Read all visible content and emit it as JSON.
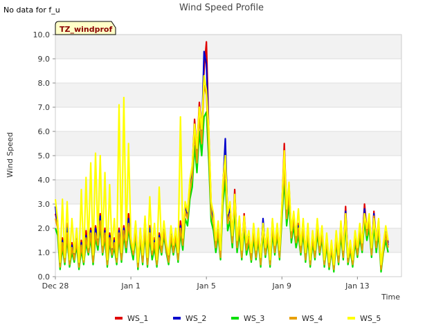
{
  "header": {
    "no_data_note": "No data for f_u",
    "badge": "TZ_windprof"
  },
  "chart_data": {
    "type": "line",
    "title": "Wind Speed Profile",
    "xlabel": "Time",
    "ylabel": "Wind Speed",
    "ylim": [
      0.0,
      10.0
    ],
    "xlim": [
      "2023-12-28",
      "2024-01-15T08:00"
    ],
    "y_ticks": [
      "0.0",
      "1.0",
      "2.0",
      "3.0",
      "4.0",
      "5.0",
      "6.0",
      "7.0",
      "8.0",
      "9.0",
      "10.0"
    ],
    "x_ticks": [
      {
        "label": "Dec 28",
        "date": "2023-12-28"
      },
      {
        "label": "Jan 1",
        "date": "2024-01-01"
      },
      {
        "label": "Jan 5",
        "date": "2024-01-05"
      },
      {
        "label": "Jan 9",
        "date": "2024-01-09"
      },
      {
        "label": "Jan 13",
        "date": "2024-01-13"
      }
    ],
    "grid": "horizontal bands",
    "legend_position": "bottom",
    "x": [
      "2023-12-28T00:00",
      "2023-12-28T03:00",
      "2023-12-28T06:00",
      "2023-12-28T09:00",
      "2023-12-28T12:00",
      "2023-12-28T15:00",
      "2023-12-28T18:00",
      "2023-12-28T21:00",
      "2023-12-29T00:00",
      "2023-12-29T03:00",
      "2023-12-29T06:00",
      "2023-12-29T09:00",
      "2023-12-29T12:00",
      "2023-12-29T15:00",
      "2023-12-29T18:00",
      "2023-12-29T21:00",
      "2023-12-30T00:00",
      "2023-12-30T03:00",
      "2023-12-30T06:00",
      "2023-12-30T09:00",
      "2023-12-30T12:00",
      "2023-12-30T15:00",
      "2023-12-30T18:00",
      "2023-12-30T21:00",
      "2023-12-31T00:00",
      "2023-12-31T03:00",
      "2023-12-31T06:00",
      "2023-12-31T09:00",
      "2023-12-31T12:00",
      "2023-12-31T15:00",
      "2023-12-31T18:00",
      "2023-12-31T21:00",
      "2024-01-01T00:00",
      "2024-01-01T03:00",
      "2024-01-01T06:00",
      "2024-01-01T09:00",
      "2024-01-01T12:00",
      "2024-01-01T15:00",
      "2024-01-01T18:00",
      "2024-01-01T21:00",
      "2024-01-02T00:00",
      "2024-01-02T03:00",
      "2024-01-02T06:00",
      "2024-01-02T09:00",
      "2024-01-02T12:00",
      "2024-01-02T15:00",
      "2024-01-02T18:00",
      "2024-01-02T21:00",
      "2024-01-03T00:00",
      "2024-01-03T03:00",
      "2024-01-03T06:00",
      "2024-01-03T09:00",
      "2024-01-03T12:00",
      "2024-01-03T15:00",
      "2024-01-03T18:00",
      "2024-01-03T21:00",
      "2024-01-04T00:00",
      "2024-01-04T03:00",
      "2024-01-04T06:00",
      "2024-01-04T09:00",
      "2024-01-04T12:00",
      "2024-01-04T15:00",
      "2024-01-04T18:00",
      "2024-01-04T21:00",
      "2024-01-05T00:00",
      "2024-01-05T03:00",
      "2024-01-05T06:00",
      "2024-01-05T09:00",
      "2024-01-05T12:00",
      "2024-01-05T15:00",
      "2024-01-05T18:00",
      "2024-01-05T21:00",
      "2024-01-06T00:00",
      "2024-01-06T03:00",
      "2024-01-06T06:00",
      "2024-01-06T09:00",
      "2024-01-06T12:00",
      "2024-01-06T15:00",
      "2024-01-06T18:00",
      "2024-01-06T21:00",
      "2024-01-07T00:00",
      "2024-01-07T03:00",
      "2024-01-07T06:00",
      "2024-01-07T09:00",
      "2024-01-07T12:00",
      "2024-01-07T15:00",
      "2024-01-07T18:00",
      "2024-01-07T21:00",
      "2024-01-08T00:00",
      "2024-01-08T03:00",
      "2024-01-08T06:00",
      "2024-01-08T09:00",
      "2024-01-08T12:00",
      "2024-01-08T15:00",
      "2024-01-08T18:00",
      "2024-01-08T21:00",
      "2024-01-09T00:00",
      "2024-01-09T03:00",
      "2024-01-09T06:00",
      "2024-01-09T09:00",
      "2024-01-09T12:00",
      "2024-01-09T15:00",
      "2024-01-09T18:00",
      "2024-01-09T21:00",
      "2024-01-10T00:00",
      "2024-01-10T03:00",
      "2024-01-10T06:00",
      "2024-01-10T09:00",
      "2024-01-10T12:00",
      "2024-01-10T15:00",
      "2024-01-10T18:00",
      "2024-01-10T21:00",
      "2024-01-11T00:00",
      "2024-01-11T03:00",
      "2024-01-11T06:00",
      "2024-01-11T09:00",
      "2024-01-11T12:00",
      "2024-01-11T15:00",
      "2024-01-11T18:00",
      "2024-01-11T21:00",
      "2024-01-12T00:00",
      "2024-01-12T03:00",
      "2024-01-12T06:00",
      "2024-01-12T09:00",
      "2024-01-12T12:00",
      "2024-01-12T15:00",
      "2024-01-12T18:00",
      "2024-01-12T21:00",
      "2024-01-13T00:00",
      "2024-01-13T03:00",
      "2024-01-13T06:00",
      "2024-01-13T09:00",
      "2024-01-13T12:00",
      "2024-01-13T15:00",
      "2024-01-13T18:00",
      "2024-01-13T21:00",
      "2024-01-14T00:00",
      "2024-01-14T03:00",
      "2024-01-14T06:00",
      "2024-01-14T09:00",
      "2024-01-14T12:00",
      "2024-01-14T15:00",
      "2024-01-14T18:00",
      "2024-01-14T21:00",
      "2024-01-15T00:00",
      "2024-01-15T03:00"
    ],
    "series": [
      {
        "name": "WS_1",
        "color": "#e00000",
        "values": [
          2.6,
          2.2,
          0.4,
          1.6,
          0.8,
          2.2,
          0.6,
          1.4,
          0.9,
          1.8,
          0.5,
          1.5,
          0.7,
          1.9,
          1.2,
          2.0,
          0.8,
          2.1,
          1.5,
          2.6,
          1.2,
          2.0,
          0.6,
          1.8,
          1.1,
          1.6,
          0.7,
          2.0,
          0.9,
          2.1,
          1.4,
          2.6,
          1.6,
          1.0,
          2.2,
          0.5,
          1.9,
          0.8,
          2.4,
          0.7,
          2.1,
          1.0,
          1.6,
          0.6,
          1.8,
          1.2,
          2.2,
          1.3,
          0.8,
          2.0,
          1.2,
          1.9,
          0.9,
          2.3,
          1.5,
          3.0,
          2.6,
          3.9,
          4.5,
          6.5,
          5.2,
          7.2,
          6.0,
          8.5,
          9.7,
          6.0,
          3.0,
          2.5,
          1.4,
          2.2,
          1.0,
          3.8,
          5.4,
          2.5,
          3.0,
          1.6,
          3.6,
          1.4,
          2.4,
          1.0,
          2.6,
          1.3,
          1.8,
          0.9,
          2.1,
          1.0,
          1.9,
          0.7,
          2.3,
          1.1,
          1.9,
          0.6,
          2.3,
          1.2,
          2.1,
          1.0,
          2.9,
          5.5,
          2.7,
          3.8,
          1.8,
          2.6,
          1.6,
          2.2,
          1.2,
          2.3,
          0.9,
          2.1,
          0.6,
          1.8,
          1.0,
          2.3,
          1.2,
          2.0,
          0.6,
          1.7,
          0.5,
          1.4,
          0.4,
          1.8,
          0.8,
          2.2,
          1.0,
          2.9,
          0.7,
          1.4,
          0.6,
          1.8,
          1.1,
          2.1,
          1.3,
          3.0,
          1.9,
          2.5,
          1.1,
          2.7,
          1.4,
          2.3,
          0.4,
          1.3,
          2.0,
          1.4
        ]
      },
      {
        "name": "WS_2",
        "color": "#0000cc",
        "values": [
          2.9,
          2.0,
          0.5,
          1.5,
          0.7,
          2.0,
          0.6,
          1.3,
          0.8,
          1.6,
          0.5,
          1.4,
          0.6,
          1.7,
          1.1,
          1.9,
          0.7,
          2.0,
          1.4,
          2.5,
          1.1,
          1.9,
          0.6,
          1.7,
          1.0,
          1.5,
          0.6,
          1.9,
          0.8,
          2.0,
          1.3,
          2.4,
          1.5,
          1.0,
          2.0,
          0.5,
          1.8,
          0.7,
          2.2,
          0.6,
          2.0,
          1.0,
          1.5,
          0.6,
          1.7,
          1.1,
          2.0,
          1.2,
          0.7,
          1.8,
          1.1,
          1.8,
          0.8,
          2.1,
          1.4,
          2.8,
          2.5,
          3.7,
          4.3,
          6.3,
          5.0,
          6.9,
          5.8,
          9.3,
          8.8,
          5.8,
          2.8,
          2.4,
          1.3,
          2.0,
          0.9,
          3.6,
          5.7,
          2.4,
          2.8,
          1.5,
          3.4,
          1.3,
          2.2,
          0.9,
          2.4,
          1.2,
          1.7,
          0.8,
          2.0,
          0.9,
          1.8,
          0.6,
          2.4,
          1.0,
          1.8,
          0.6,
          2.2,
          1.1,
          2.0,
          0.9,
          2.8,
          4.9,
          2.6,
          3.6,
          1.7,
          2.5,
          1.5,
          2.1,
          1.1,
          2.2,
          0.8,
          2.0,
          0.6,
          1.7,
          0.9,
          2.2,
          1.1,
          1.9,
          0.6,
          1.6,
          0.5,
          1.3,
          0.4,
          1.7,
          0.7,
          2.1,
          0.9,
          2.7,
          0.7,
          1.3,
          0.6,
          1.7,
          1.0,
          2.0,
          1.2,
          2.8,
          1.8,
          2.4,
          1.0,
          2.6,
          1.3,
          2.2,
          0.4,
          1.2,
          1.9,
          1.3
        ]
      },
      {
        "name": "WS_3",
        "color": "#00e000",
        "values": [
          2.0,
          1.7,
          0.3,
          1.2,
          0.5,
          1.6,
          0.4,
          1.0,
          0.6,
          1.3,
          0.3,
          1.1,
          0.5,
          1.4,
          0.9,
          1.6,
          0.5,
          1.6,
          1.1,
          2.1,
          0.9,
          1.6,
          0.4,
          1.4,
          0.8,
          1.2,
          0.5,
          1.6,
          0.6,
          1.7,
          1.0,
          2.0,
          1.2,
          0.7,
          1.7,
          0.3,
          1.5,
          0.5,
          1.8,
          0.4,
          1.6,
          0.7,
          1.2,
          0.4,
          1.4,
          0.9,
          1.7,
          1.0,
          0.5,
          1.5,
          0.9,
          1.5,
          0.6,
          1.8,
          1.1,
          2.4,
          2.1,
          3.2,
          3.7,
          5.4,
          4.3,
          6.0,
          5.0,
          6.6,
          6.8,
          4.8,
          2.3,
          1.9,
          1.0,
          1.7,
          0.7,
          3.0,
          4.0,
          1.9,
          2.3,
          1.2,
          2.8,
          1.0,
          1.8,
          0.7,
          2.0,
          0.9,
          1.4,
          0.6,
          1.6,
          0.7,
          1.5,
          0.4,
          1.8,
          0.8,
          1.5,
          0.4,
          1.8,
          0.9,
          1.7,
          0.7,
          2.4,
          4.0,
          2.1,
          3.0,
          1.4,
          2.1,
          1.2,
          1.7,
          0.9,
          1.8,
          0.6,
          1.6,
          0.4,
          1.4,
          0.7,
          1.8,
          0.9,
          1.6,
          0.4,
          1.3,
          0.3,
          1.1,
          0.2,
          1.4,
          0.5,
          1.7,
          0.7,
          2.2,
          0.5,
          1.1,
          0.4,
          1.4,
          0.8,
          1.6,
          1.0,
          2.3,
          1.5,
          2.0,
          0.8,
          2.1,
          1.0,
          1.8,
          0.2,
          1.0,
          1.5,
          1.0
        ]
      },
      {
        "name": "WS_4",
        "color": "#e8a000",
        "values": [
          2.4,
          2.0,
          0.4,
          1.4,
          0.6,
          1.8,
          0.5,
          1.2,
          0.7,
          1.5,
          0.4,
          1.3,
          0.6,
          1.6,
          1.0,
          1.8,
          0.6,
          1.8,
          1.3,
          2.3,
          1.0,
          1.8,
          0.5,
          1.6,
          0.9,
          1.4,
          0.6,
          1.8,
          0.7,
          1.9,
          1.2,
          2.2,
          1.4,
          0.9,
          1.9,
          0.4,
          1.7,
          0.6,
          2.0,
          0.5,
          1.8,
          0.9,
          1.4,
          0.5,
          1.6,
          1.0,
          1.9,
          1.1,
          0.6,
          1.7,
          1.0,
          1.7,
          0.7,
          2.0,
          1.3,
          2.7,
          2.4,
          3.5,
          4.1,
          6.0,
          4.7,
          6.6,
          5.5,
          7.9,
          7.5,
          5.3,
          2.6,
          2.2,
          1.2,
          1.9,
          0.8,
          3.4,
          4.6,
          2.2,
          2.6,
          1.4,
          3.2,
          1.2,
          2.1,
          0.8,
          2.3,
          1.1,
          1.6,
          0.7,
          1.9,
          0.8,
          1.7,
          0.5,
          2.1,
          0.9,
          1.7,
          0.5,
          2.1,
          1.0,
          1.9,
          0.8,
          2.7,
          4.5,
          2.4,
          3.4,
          1.6,
          2.4,
          1.4,
          2.0,
          1.0,
          2.1,
          0.7,
          1.9,
          0.5,
          1.6,
          0.8,
          2.1,
          1.0,
          1.8,
          0.5,
          1.5,
          0.4,
          1.2,
          0.3,
          1.6,
          0.6,
          2.0,
          0.8,
          2.5,
          0.6,
          1.2,
          0.5,
          1.6,
          0.9,
          1.9,
          1.1,
          2.6,
          1.7,
          2.3,
          0.9,
          2.5,
          1.2,
          2.1,
          0.3,
          1.1,
          1.8,
          1.2
        ]
      },
      {
        "name": "WS_5",
        "color": "#ffff00",
        "values": [
          3.2,
          2.3,
          0.6,
          3.2,
          0.8,
          3.1,
          0.7,
          2.4,
          1.0,
          2.0,
          0.6,
          3.6,
          0.7,
          4.1,
          1.2,
          4.7,
          0.9,
          5.1,
          1.6,
          5.0,
          1.3,
          4.3,
          0.7,
          3.8,
          1.2,
          2.4,
          0.8,
          7.1,
          1.0,
          7.4,
          1.5,
          5.5,
          1.6,
          1.1,
          2.3,
          0.6,
          2.0,
          0.9,
          2.5,
          0.8,
          3.3,
          1.1,
          2.2,
          0.7,
          3.7,
          1.3,
          2.3,
          1.4,
          0.9,
          2.1,
          1.3,
          2.0,
          1.0,
          6.6,
          1.6,
          3.1,
          2.7,
          4.0,
          4.6,
          6.3,
          5.3,
          7.0,
          6.1,
          8.3,
          7.7,
          6.1,
          3.1,
          2.6,
          1.5,
          2.3,
          1.1,
          3.9,
          5.0,
          2.6,
          3.1,
          1.7,
          3.4,
          1.5,
          2.5,
          1.1,
          2.5,
          1.4,
          1.9,
          1.0,
          2.2,
          1.1,
          2.0,
          0.8,
          2.2,
          1.2,
          2.0,
          0.7,
          2.4,
          1.3,
          2.2,
          1.1,
          3.0,
          5.2,
          2.8,
          3.9,
          1.9,
          2.7,
          1.7,
          2.8,
          1.3,
          2.4,
          1.0,
          2.2,
          0.7,
          1.9,
          1.1,
          2.4,
          1.3,
          2.1,
          0.7,
          1.8,
          0.6,
          1.5,
          0.5,
          1.9,
          0.9,
          2.3,
          1.1,
          2.6,
          0.8,
          1.5,
          0.7,
          1.9,
          1.2,
          2.2,
          1.4,
          2.6,
          2.0,
          2.6,
          1.2,
          2.4,
          1.5,
          2.4,
          0.5,
          1.4,
          2.1,
          1.5
        ]
      }
    ]
  }
}
